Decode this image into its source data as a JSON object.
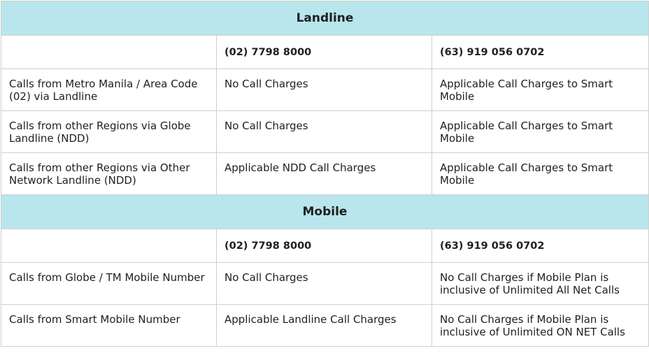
{
  "sections": [
    {
      "title": "Landline",
      "columns": [
        "",
        "(02) 7798 8000",
        "(63) 919 056 0702"
      ],
      "rows": [
        [
          "Calls from Metro Manila / Area Code (02) via Landline",
          "No Call Charges",
          "Applicable Call Charges to Smart Mobile"
        ],
        [
          "Calls from other Regions via Globe Landline (NDD)",
          "No Call Charges",
          "Applicable Call Charges to Smart Mobile"
        ],
        [
          "Calls from other Regions via Other Network Landline (NDD)",
          "Applicable NDD Call Charges",
          "Applicable Call Charges to Smart Mobile"
        ]
      ]
    },
    {
      "title": "Mobile",
      "columns": [
        "",
        "(02) 7798 8000",
        "(63) 919 056 0702"
      ],
      "rows": [
        [
          "Calls from Globe / TM Mobile Number",
          "No Call Charges",
          "No Call Charges if Mobile Plan is inclusive of Unlimited All Net Calls"
        ],
        [
          "Calls from Smart Mobile Number",
          "Applicable Landline Call Charges",
          "No Call Charges if Mobile Plan is inclusive of Unlimited ON NET Calls"
        ]
      ]
    }
  ],
  "colors": {
    "section_header_bg": "#b8e6ec",
    "border": "#cfcfcf",
    "text": "#1f1f1f"
  }
}
